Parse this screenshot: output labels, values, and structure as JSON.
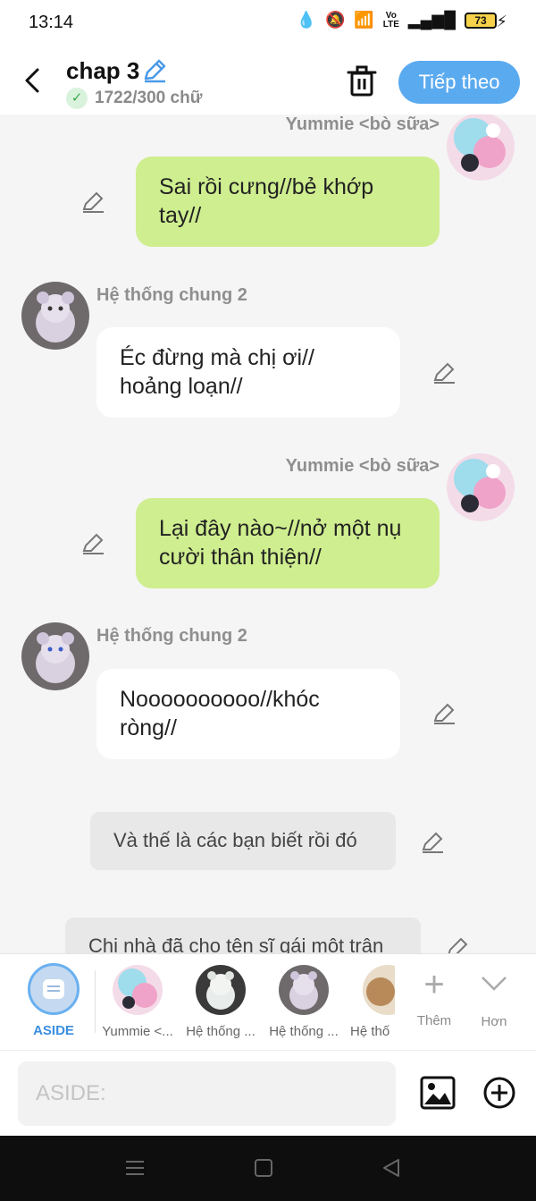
{
  "status_bar": {
    "time": "13:14",
    "battery": "73",
    "network_label": "Vo LTE"
  },
  "header": {
    "title": "chap 3",
    "word_count": "1722/300 chữ",
    "next_label": "Tiếp theo"
  },
  "messages": [
    {
      "speaker": "Yummie <bò sữa>",
      "text": "Sai rồi cưng//bẻ khớp tay//",
      "side": "right"
    },
    {
      "speaker": "Hệ thống chung 2",
      "text": "Éc đừng mà chị ơi// hoảng loạn//",
      "side": "left"
    },
    {
      "speaker": "Yummie <bò sữa>",
      "text": "Lại đây nào~//nở một nụ cười thân thiện//",
      "side": "right"
    },
    {
      "speaker": "Hệ thống chung 2",
      "text": "Noooooooooo//khóc ròng//",
      "side": "left"
    },
    {
      "speaker": "",
      "text": "Và thế là các bạn biết rồi đó",
      "side": "aside"
    },
    {
      "speaker": "",
      "text": "Chị nhà đã cho tên sĩ gái một trận",
      "side": "aside"
    }
  ],
  "character_bar": {
    "aside_label": "ASIDE",
    "characters": [
      "Yummie <...",
      "Hệ thống ...",
      "Hệ thống ...",
      "Hệ thố"
    ],
    "more_label": "Thêm",
    "collapse_label": "Hơn"
  },
  "input": {
    "placeholder": "ASIDE:"
  },
  "colors": {
    "accent": "#5aaaf0",
    "own_bubble": "#cfee8f",
    "other_bubble": "#ffffff",
    "aside_bubble": "#e8e8e8"
  }
}
